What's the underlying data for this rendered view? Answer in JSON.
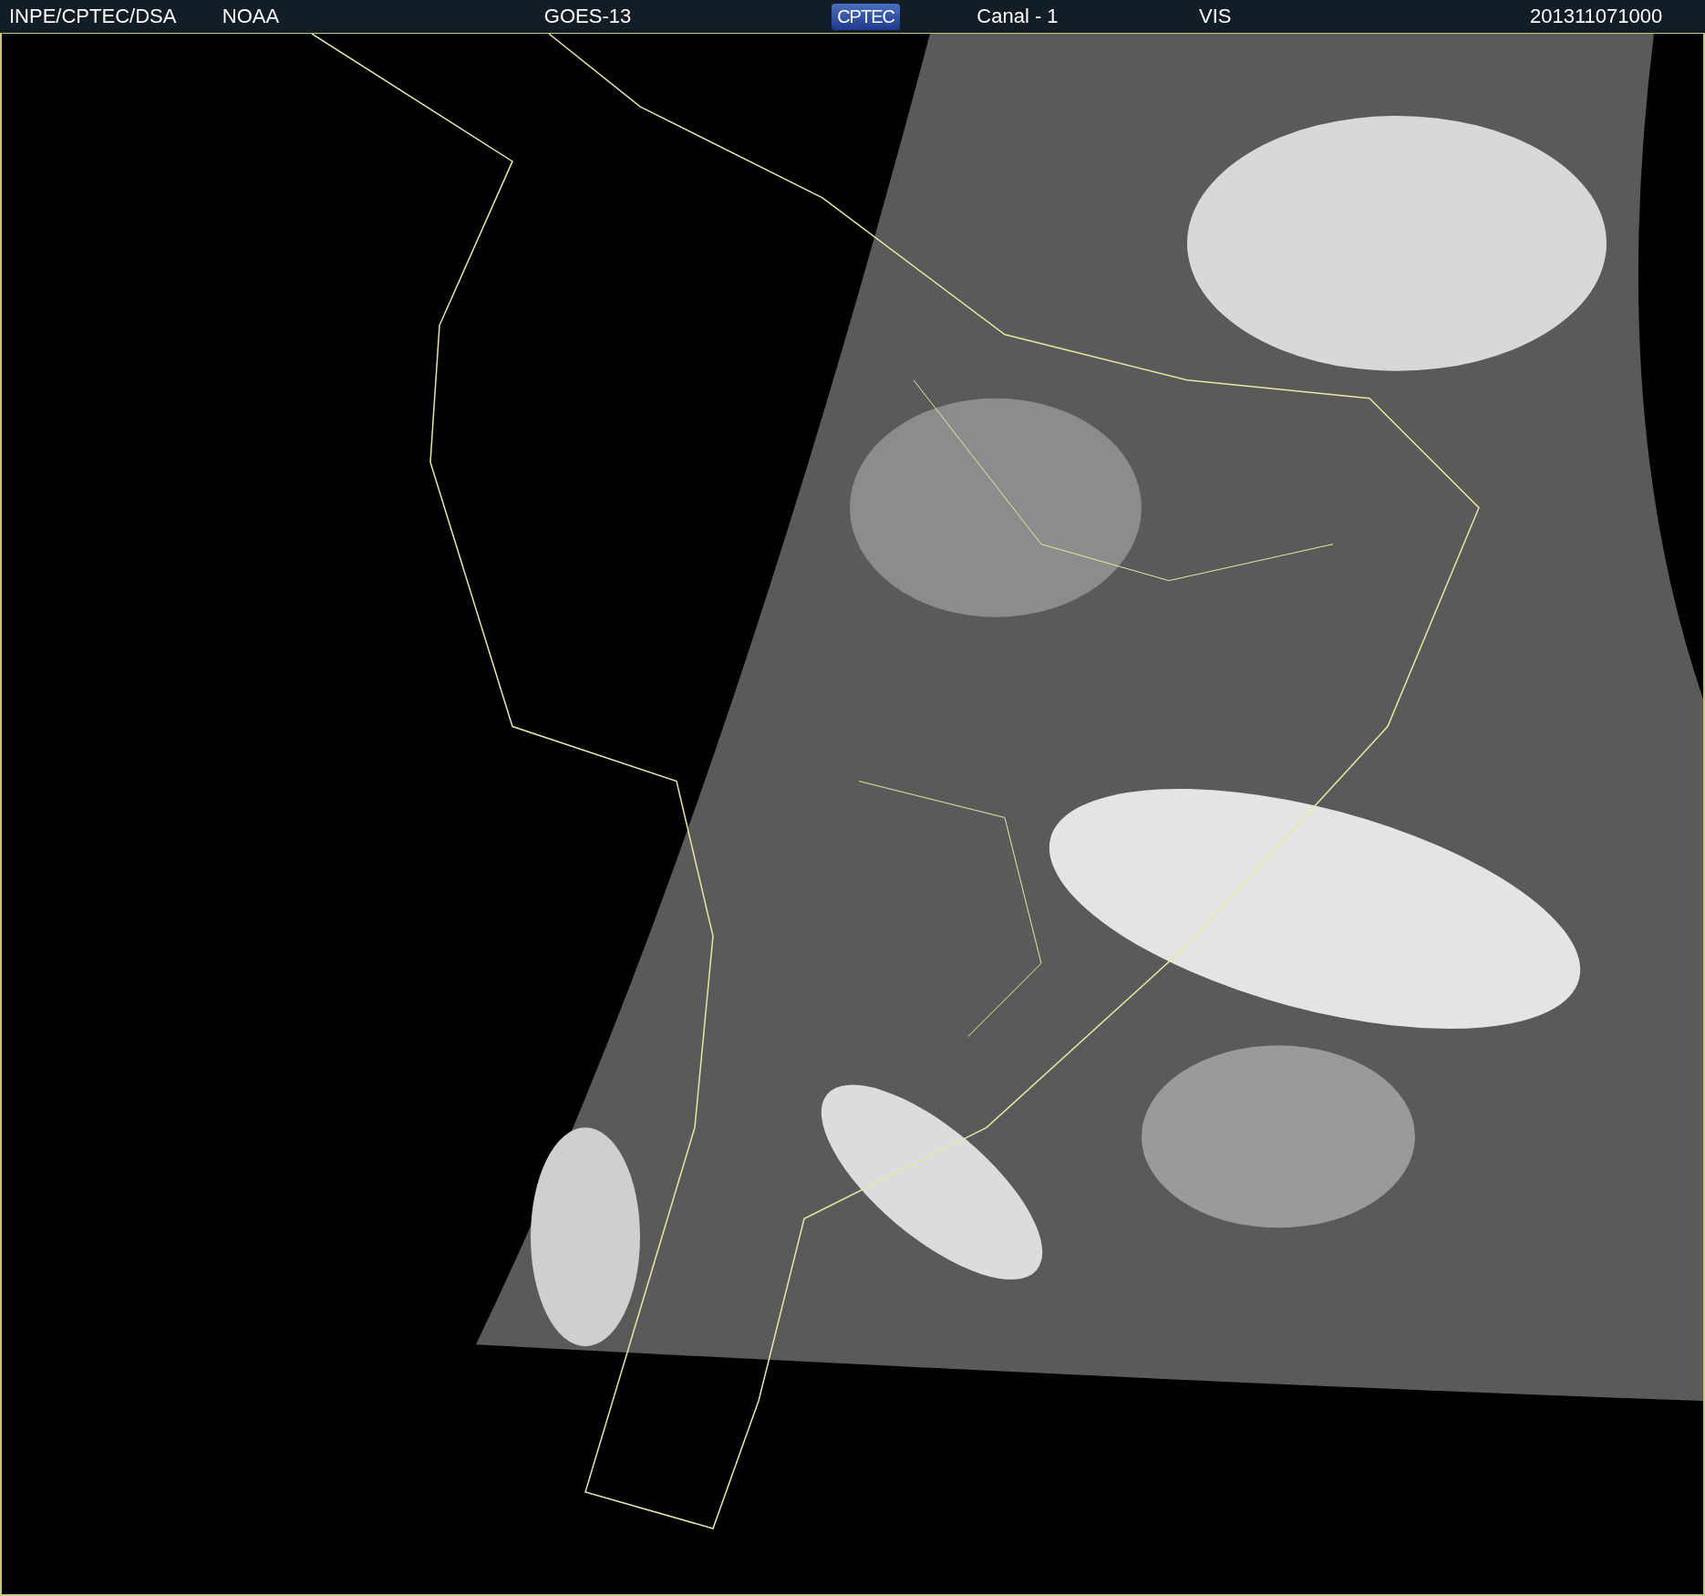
{
  "header": {
    "items": [
      {
        "kind": "text",
        "text": "INPE/CPTEC/DSA"
      },
      {
        "kind": "text",
        "text": "NOAA"
      },
      {
        "kind": "text",
        "text": "GOES-13"
      },
      {
        "kind": "logo",
        "text": "CPTEC"
      },
      {
        "kind": "text",
        "text": "Canal - 1"
      },
      {
        "kind": "text",
        "text": "VIS"
      },
      {
        "kind": "text",
        "text": "201311071000"
      }
    ]
  }
}
